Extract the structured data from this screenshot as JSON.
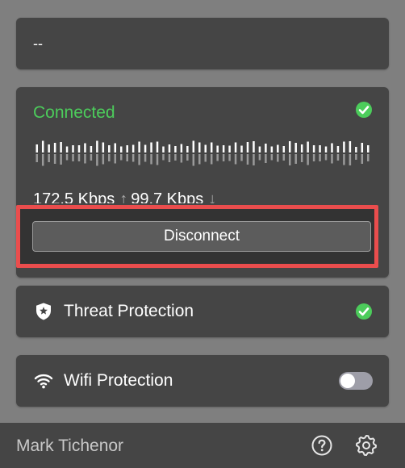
{
  "top": {
    "value": "--"
  },
  "connection": {
    "status": "Connected",
    "download_speed": "172.5 Kbps",
    "upload_speed": "99.7 Kbps",
    "disconnect_label": "Disconnect",
    "status_color": "#4ccc5b"
  },
  "features": [
    {
      "label": "Threat Protection",
      "icon": "shield-star-icon",
      "state": "enabled"
    },
    {
      "label": "Wifi Protection",
      "icon": "wifi-icon",
      "state": "off"
    }
  ],
  "footer": {
    "user_name": "Mark Tichenor"
  },
  "colors": {
    "panel": "#454545",
    "background": "#7f7f7f",
    "highlight": "#ea4d4d",
    "accent_green": "#4ccc5b"
  }
}
